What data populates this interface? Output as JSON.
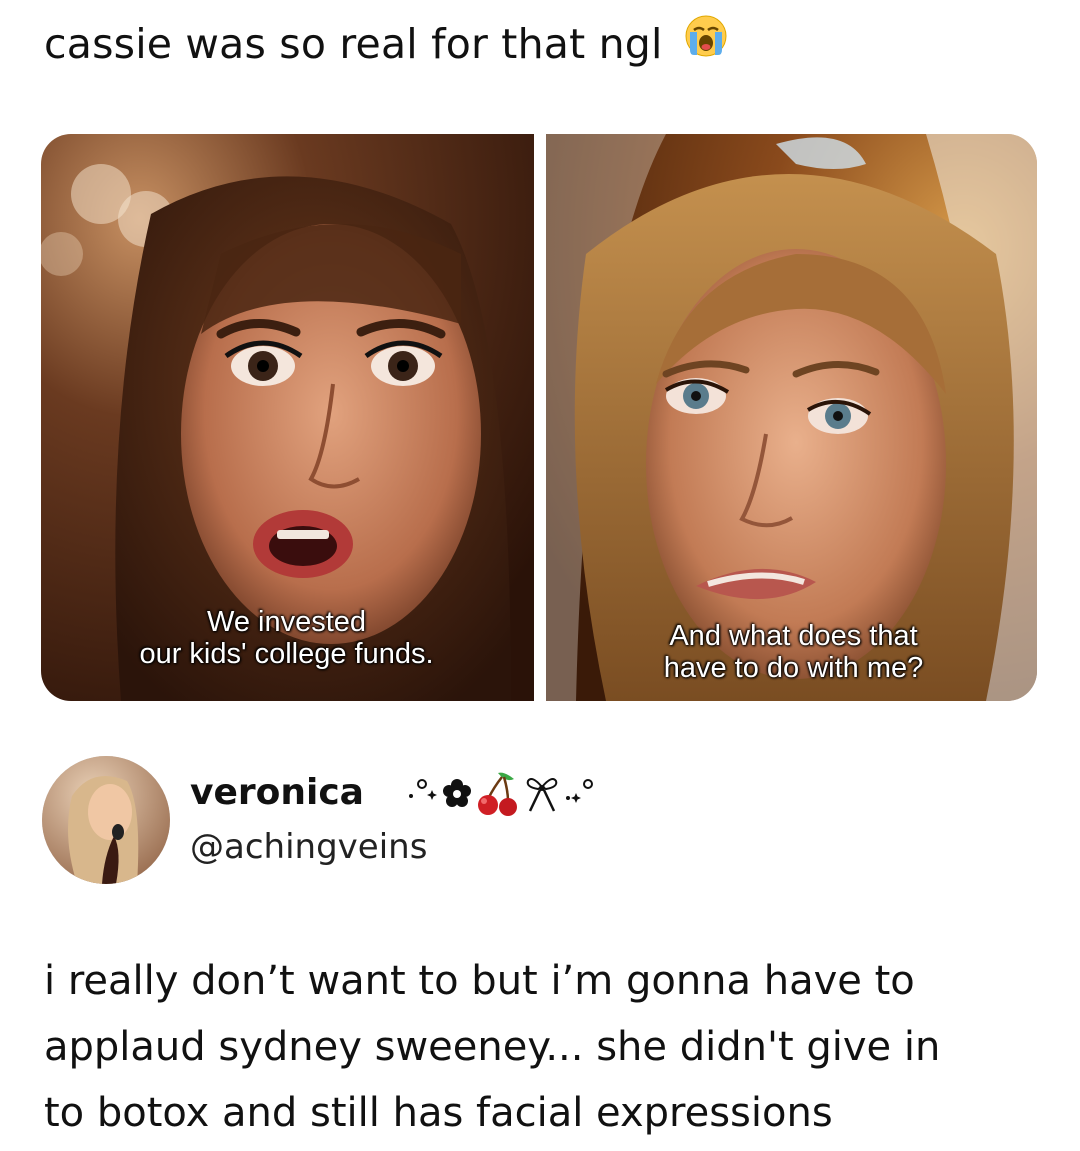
{
  "caption": {
    "text": "cassie was so real for that ngl",
    "emoji": "loudly-crying-face-icon"
  },
  "meme": {
    "left_panel": {
      "subtitle_lines": [
        "We invested",
        "our kids' college funds."
      ]
    },
    "right_panel": {
      "subtitle_lines": [
        "And what does that",
        "have to do with me?"
      ]
    }
  },
  "post": {
    "author": {
      "display_name": "veronica",
      "display_name_decorations": [
        "sparkle-dots-icon",
        "flower-icon",
        "cherries-icon",
        "bow-icon",
        "sparkle-dots-icon"
      ],
      "handle": "@achingveins"
    },
    "text_lines": [
      "i really don’t want to but i’m gonna have to",
      "applaud sydney sweeney... she didn't give in",
      "to botox and still has facial expressions"
    ]
  },
  "colors": {
    "background": "#ffffff",
    "text": "#111111",
    "subtitle": "#ffffff"
  }
}
